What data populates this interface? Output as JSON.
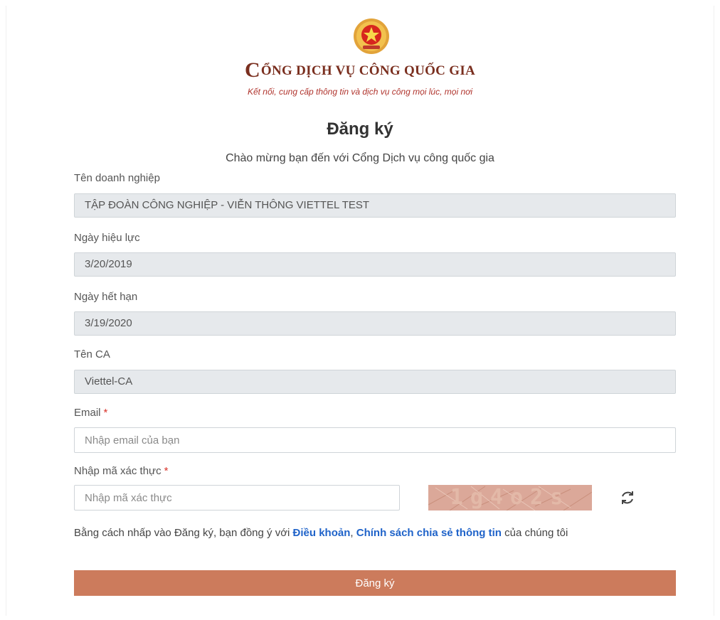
{
  "brand": {
    "emblem_icon": "vietnam-national-emblem-icon",
    "title_cap": "C",
    "title_rest": "ỔNG DỊCH VỤ CÔNG QUỐC GIA",
    "tagline": "Kết nối, cung cấp thông tin và dịch vụ công mọi lúc, mọi nơi",
    "title_color": "#7a2f1f",
    "tagline_color": "#b0342d"
  },
  "page": {
    "title": "Đăng ký",
    "welcome": "Chào mừng bạn đến với Cổng Dịch vụ công quốc gia"
  },
  "form": {
    "company_label": "Tên doanh nghiệp",
    "company_value": "TẬP ĐOÀN CÔNG NGHIỆP - VIỄN THÔNG VIETTEL TEST",
    "effective_label": "Ngày hiệu lực",
    "effective_value": "3/20/2019",
    "expiry_label": "Ngày hết hạn",
    "expiry_value": "3/19/2020",
    "ca_label": "Tên CA",
    "ca_value": "Viettel-CA",
    "email_label": "Email",
    "email_placeholder": "Nhập email của bạn",
    "captcha_label": "Nhập mã xác thực",
    "captcha_placeholder": "Nhập mã xác thực",
    "captcha_code": "1g4o2s",
    "required_mark": "*",
    "refresh_icon": "refresh-icon"
  },
  "terms": {
    "prefix": "Bằng cách nhấp vào Đăng ký, bạn đồng ý với ",
    "link_terms": "Điều khoản",
    "separator": ", ",
    "link_policy": "Chính sách chia sẻ thông tin",
    "suffix": " của chúng tôi"
  },
  "submit_label": "Đăng ký",
  "colors": {
    "submit_bg": "#cc7b5c",
    "link": "#1f63c9",
    "required": "#d9342b",
    "readonly_bg": "#e6e9ec"
  }
}
